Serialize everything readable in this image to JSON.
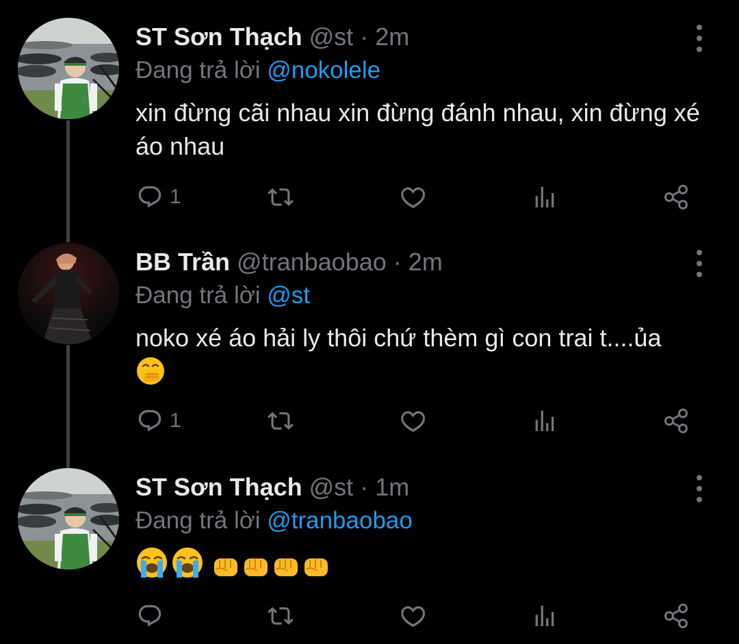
{
  "tweets": [
    {
      "name": "ST Sơn Thạch",
      "handle": "@st",
      "separator": "·",
      "time": "2m",
      "reply_prefix": "Đang trả lời",
      "reply_to": "@nokolele",
      "text": "xin đừng cãi nhau xin đừng đánh nhau, xin đừng xé áo nhau",
      "reply_count": "1",
      "avatar_icon": "person-green-vest-avatar"
    },
    {
      "name": "BB Trần",
      "handle": "@tranbaobao",
      "separator": "·",
      "time": "2m",
      "reply_prefix": "Đang trả lời",
      "reply_to": "@st",
      "text": "noko xé áo hải ly thôi chứ thèm gì con trai t....ủa",
      "reply_count": "1",
      "emoji": "face-with-hand-over-mouth",
      "avatar_icon": "dark-costume-avatar"
    },
    {
      "name": "ST Sơn Thạch",
      "handle": "@st",
      "separator": "·",
      "time": "1m",
      "reply_prefix": "Đang trả lời",
      "reply_to": "@tranbaobao",
      "text": "",
      "reply_count": "",
      "emojis": [
        "loudly-crying-face",
        "loudly-crying-face",
        "oncoming-fist",
        "oncoming-fist",
        "oncoming-fist",
        "oncoming-fist"
      ],
      "avatar_icon": "person-green-vest-avatar"
    }
  ],
  "colors": {
    "background": "#000000",
    "primary_text": "#e7e9ea",
    "secondary_text": "#71767b",
    "link": "#1d9bf0",
    "thread_line": "#3e4144"
  },
  "icons": {
    "reply": "reply-icon",
    "retweet": "retweet-icon",
    "like": "like-icon",
    "views": "views-icon",
    "share": "share-icon",
    "more": "more-icon"
  }
}
